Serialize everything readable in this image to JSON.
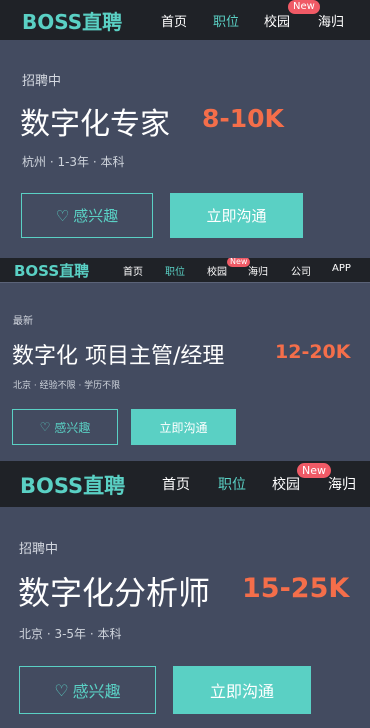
{
  "logo": "BOSS直聘",
  "nav": {
    "home": "首页",
    "jobs": "职位",
    "campus": "校园",
    "overseas": "海归",
    "company": "公司",
    "app": "APP",
    "new_badge": "New"
  },
  "interest_label": "感兴趣",
  "chat_label": "立即沟通",
  "jobs": [
    {
      "status": "招聘中",
      "title": "数字化专家",
      "salary": "8-10K",
      "meta": "杭州 · 1-3年 · 本科"
    },
    {
      "status": "最新",
      "title": "数字化 项目主管/经理",
      "salary": "12-20K",
      "meta": "北京 · 经验不限 · 学历不限"
    },
    {
      "status": "招聘中",
      "title": "数字化分析师",
      "salary": "15-25K",
      "meta": "北京 · 3-5年 · 本科"
    }
  ],
  "colors": {
    "accent": "#5ad0c4",
    "salary": "#f46e4a",
    "badge": "#f05a66",
    "topbar": "#1f2227",
    "panel": "#434b60"
  }
}
